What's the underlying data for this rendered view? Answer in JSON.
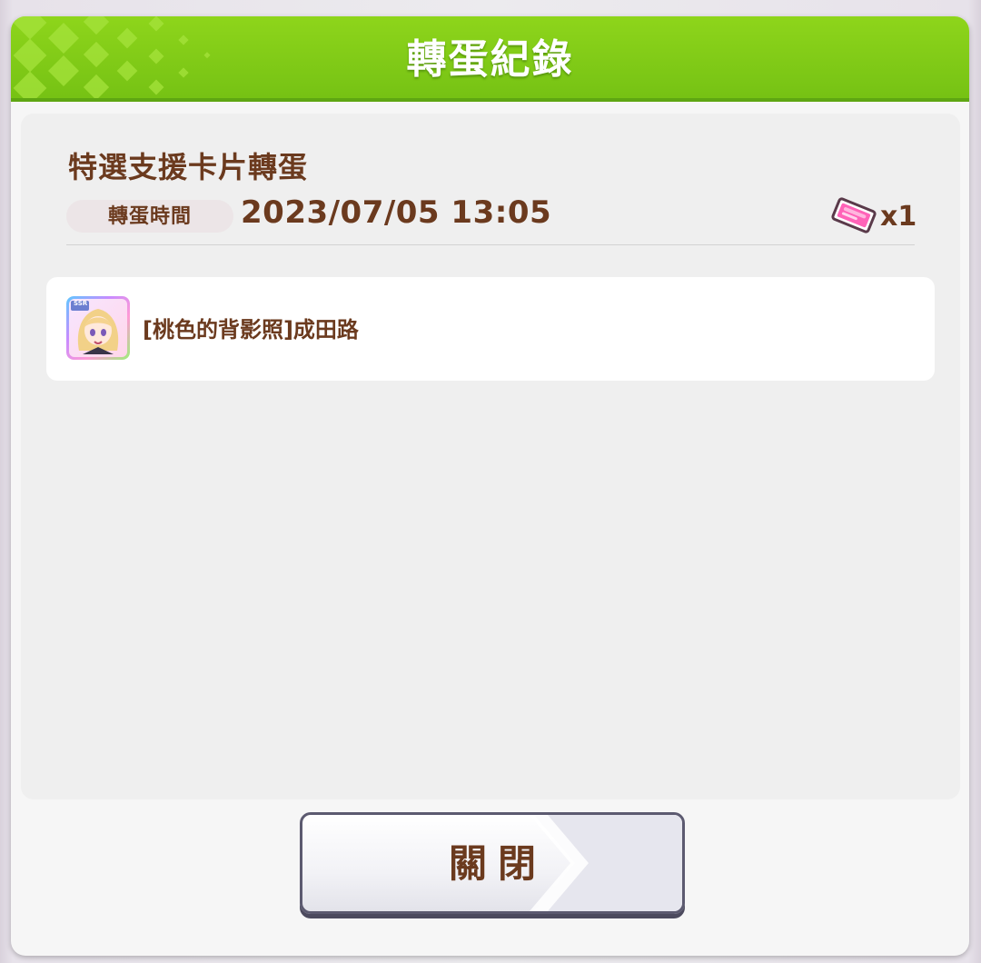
{
  "dialog": {
    "title": "轉蛋紀錄",
    "gacha_name": "特選支援卡片轉蛋",
    "time_label": "轉蛋時間",
    "time_value": "2023/07/05 13:05",
    "cost": {
      "icon": "ticket-icon",
      "quantity": "x1"
    },
    "results": [
      {
        "rarity": "SSR",
        "name": "[桃色的背影照]成田路",
        "icon": "support-card-thumbnail"
      }
    ],
    "close_label": "關閉"
  },
  "colors": {
    "header_green": "#7fc817",
    "text_brown": "#6b3a1e",
    "panel_bg": "#efefef",
    "ticket_pink": "#ff63b8"
  }
}
